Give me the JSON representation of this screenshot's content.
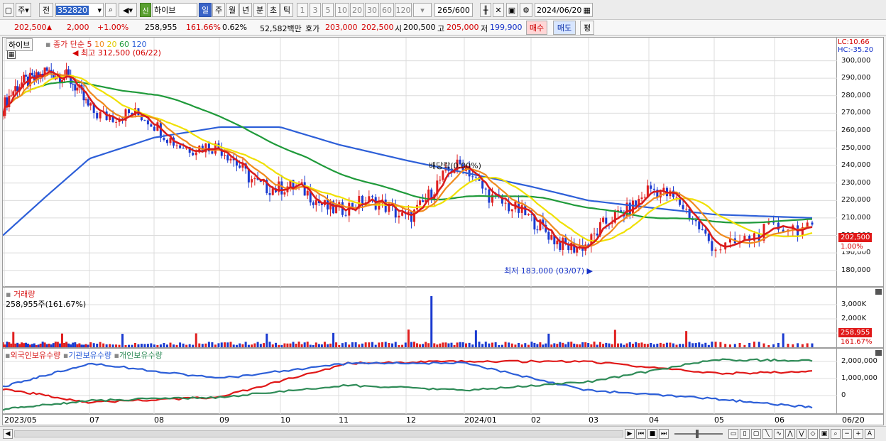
{
  "toolbar": {
    "period_label": "주",
    "prev_label": "전",
    "code": "352820",
    "stock_badge": "신",
    "stock_name": "하이브",
    "intervals": [
      "일",
      "주",
      "월",
      "년",
      "분",
      "초",
      "틱"
    ],
    "active_interval": "일",
    "num_buttons": [
      "1",
      "3",
      "5",
      "10",
      "20",
      "30",
      "60",
      "120"
    ],
    "count_display": "265",
    "count_total": "/600",
    "date": "2024/06/20"
  },
  "quote": {
    "price": "202,500",
    "change": "2,000",
    "change_pct": "+1.00%",
    "volume": "258,955",
    "volume_ratio": "161.66%",
    "turnover_rate": "0.62%",
    "amount": "52,582백만",
    "hoga_label": "호가",
    "hoga_ask": "203,000",
    "hoga_bid": "202,500",
    "open_label": "시",
    "open": "200,500",
    "high_label": "고",
    "high": "205,000",
    "low_label": "저",
    "low": "199,900",
    "buy_label": "매수",
    "sell_label": "매도",
    "eval_label": "평"
  },
  "price_panel": {
    "stock_tab": "하이브",
    "legend_title": "종가 단순",
    "ma_labels": [
      "5",
      "10",
      "20",
      "60",
      "120"
    ],
    "ma_colors": [
      "#d81c1c",
      "#f08a1c",
      "#f0e000",
      "#1f9a3a",
      "#2d5fd8"
    ],
    "lc": "LC:10.66",
    "hc": "HC:-35.20",
    "annot_high": "최고 312,500 (06/22)",
    "annot_low": "최저 183,000 (03/07)",
    "annot_div": "배당락(0.00%)",
    "price_tag": "202,500",
    "pct_tag": "1.00%"
  },
  "volume_panel": {
    "title": "거래량",
    "value": "258,955주(161.67%)",
    "tag_value": "258,955",
    "tag_pct": "161.67%"
  },
  "holdings_panel": {
    "foreign": "외국인보유수량",
    "institution": "기관보유수량",
    "individual": "개인보유수량"
  },
  "x_labels": [
    "2023/05",
    "07",
    "08",
    "09",
    "10",
    "11",
    "12",
    "2024/01",
    "02",
    "03",
    "04",
    "05",
    "06",
    "06/20"
  ],
  "chart_data": [
    {
      "type": "line",
      "title": "하이브",
      "ylim": [
        175000,
        310000
      ],
      "yticks": [
        180000,
        190000,
        200000,
        210000,
        220000,
        230000,
        240000,
        250000,
        260000,
        270000,
        280000,
        290000,
        300000
      ],
      "x": [
        "2023/05",
        "2023/06",
        "2023/07",
        "2023/08",
        "2023/09",
        "2023/10",
        "2023/11",
        "2023/12",
        "2024/01",
        "2024/02",
        "2024/03",
        "2024/04",
        "2024/05",
        "2024/06/20"
      ],
      "series": [
        {
          "name": "5",
          "values": [
            273000,
            298000,
            275000,
            262000,
            246000,
            226000,
            218000,
            213000,
            240000,
            205000,
            193000,
            230000,
            197000,
            202500
          ]
        },
        {
          "name": "120",
          "values": [
            200000,
            222000,
            244000,
            256000,
            262000,
            262000,
            252000,
            243000,
            236000,
            228000,
            220000,
            216000,
            212000,
            210000
          ]
        }
      ]
    },
    {
      "type": "bar",
      "title": "거래량",
      "ylim": [
        0,
        4000000
      ],
      "yticks": [
        1000000,
        2000000,
        3000000
      ],
      "ytick_labels": [
        "1,000K",
        "2,000K",
        "3,000K"
      ],
      "last_value": 258955,
      "last_ratio": "161.67%"
    },
    {
      "type": "line",
      "ylim": [
        -1000000,
        2500000
      ],
      "yticks": [
        0,
        1000000,
        2000000
      ],
      "ytick_labels": [
        "0",
        "1,000,000",
        "2,000,000"
      ],
      "x": [
        "2023/05",
        "2023/07",
        "2023/09",
        "2023/11",
        "2024/01",
        "2024/03",
        "2024/05",
        "2024/06/20"
      ],
      "series": [
        {
          "name": "외국인보유수량",
          "values": [
            400000,
            -400000,
            -100000,
            1900000,
            2000000,
            2000000,
            1300000,
            1400000
          ]
        },
        {
          "name": "기관보유수량",
          "values": [
            500000,
            1900000,
            1000000,
            1900000,
            1900000,
            300000,
            -200000,
            -700000
          ]
        },
        {
          "name": "개인보유수량",
          "values": [
            -800000,
            -300000,
            -100000,
            600000,
            300000,
            800000,
            2100000,
            2050000
          ]
        }
      ]
    }
  ]
}
